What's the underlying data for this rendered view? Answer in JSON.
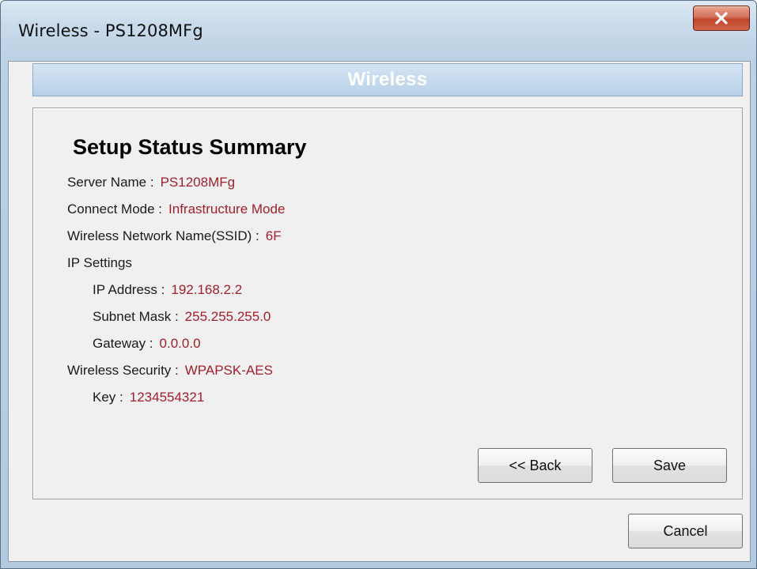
{
  "window": {
    "title": "Wireless - PS1208MFg",
    "close_label": "X"
  },
  "banner": {
    "title": "Wireless"
  },
  "summary": {
    "heading": "Setup Status Summary",
    "server_name": {
      "label": "Server Name :",
      "value": "PS1208MFg"
    },
    "connect_mode": {
      "label": "Connect Mode :",
      "value": "Infrastructure Mode"
    },
    "ssid": {
      "label": "Wireless Network Name(SSID) :",
      "value": "6F"
    },
    "ip_settings": {
      "label": "IP Settings"
    },
    "ip_address": {
      "label": "IP Address :",
      "value": "192.168.2.2"
    },
    "subnet_mask": {
      "label": "Subnet Mask :",
      "value": "255.255.255.0"
    },
    "gateway": {
      "label": "Gateway :",
      "value": "0.0.0.0"
    },
    "wireless_security": {
      "label": "Wireless Security :",
      "value": "WPAPSK-AES"
    },
    "key": {
      "label": "Key :",
      "value": "1234554321"
    }
  },
  "buttons": {
    "back": "<< Back",
    "save": "Save",
    "cancel": "Cancel"
  },
  "colors": {
    "value_text": "#a0202c",
    "banner_text": "#ffffff",
    "close_button": "#c0452d"
  },
  "icons": {
    "close": "close-icon"
  }
}
